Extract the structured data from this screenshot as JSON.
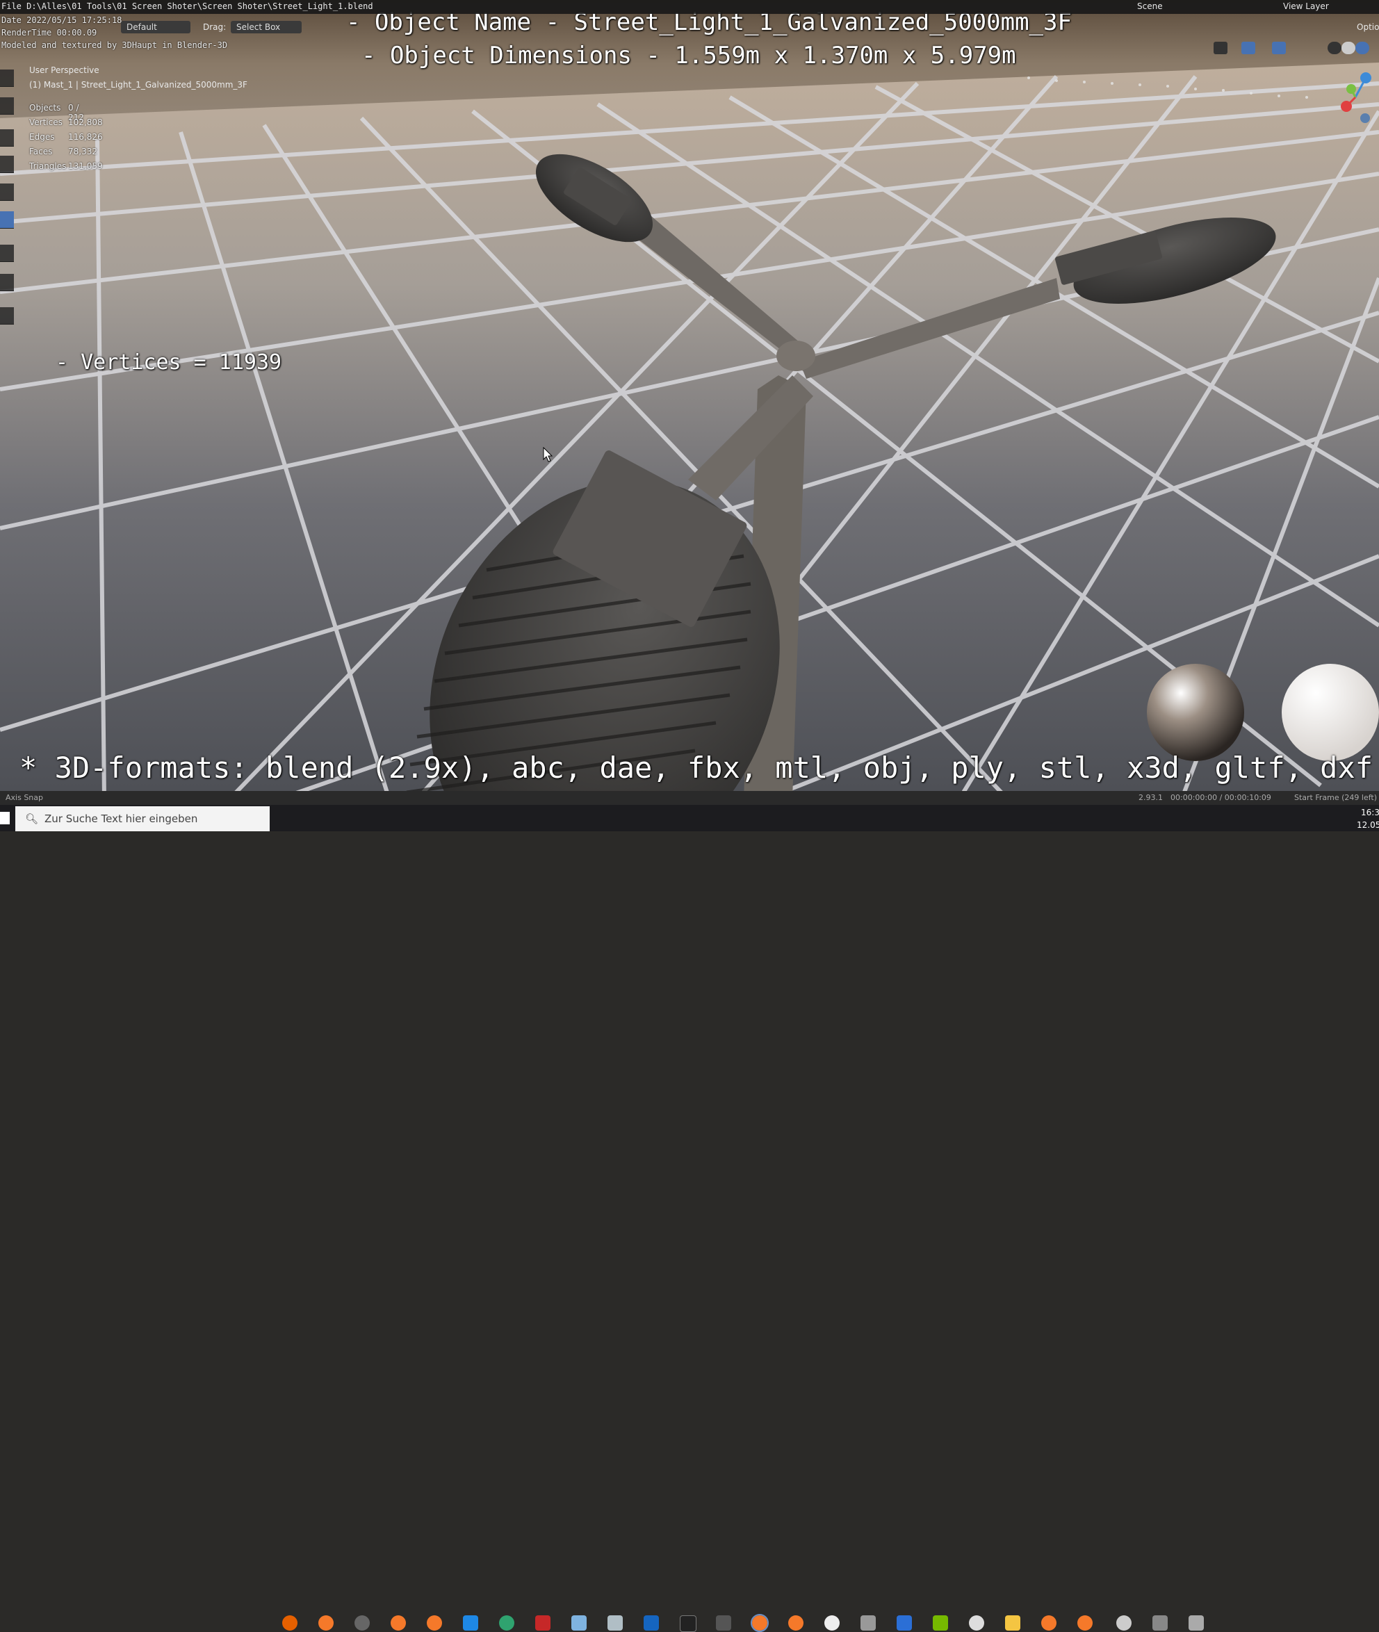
{
  "window": {
    "file_path": "File D:\\Alles\\01 Tools\\01 Screen Shoter\\Screen Shoter\\Street_Light_1.blend",
    "date": "Date 2022/05/15 17:25:18",
    "render_time": "RenderTime 00:00.09",
    "credit": "Modeled and textured by 3DHaupt in Blender-3D"
  },
  "header": {
    "workspace_value": "Default",
    "drag_label": "Drag:",
    "drag_value": "Select Box",
    "scene_label": "Scene",
    "view_layer_label": "View Layer",
    "options_label": "Option"
  },
  "viewport": {
    "perspective": "User Perspective",
    "object_path": "(1) Mast_1 | Street_Light_1_Galvanized_5000mm_3F",
    "stats": [
      {
        "label": "Objects",
        "value": "0 / 212"
      },
      {
        "label": "Vertices",
        "value": "102,808"
      },
      {
        "label": "Edges",
        "value": "116,826"
      },
      {
        "label": "Faces",
        "value": "78,332"
      },
      {
        "label": "Triangles",
        "value": "131,059"
      }
    ]
  },
  "overlay": {
    "object_name": "- Object Name - Street_Light_1_Galvanized_5000mm_3F",
    "object_dimensions": "- Object Dimensions -  1.559m x 1.370m x 5.979m",
    "vertices": "- Vertices = 11939",
    "formats": "* 3D-formats: blend (2.9x), abc, dae, fbx, mtl, obj, ply, stl, x3d, gltf, dxf"
  },
  "status_bar": {
    "left": "Axis Snap",
    "version": "2.93.1",
    "timecode": "00:00:00:00 / 00:00:10:09",
    "frame": "Start Frame (249 left)"
  },
  "taskbar": {
    "search_placeholder": "Zur Suche Text hier eingeben",
    "clock_time": "16:3",
    "clock_date": "12.05"
  },
  "colors": {
    "accent": "#4772b3",
    "axis_x": "#e04040",
    "axis_y": "#7ac043",
    "axis_z": "#3d8bd8"
  }
}
